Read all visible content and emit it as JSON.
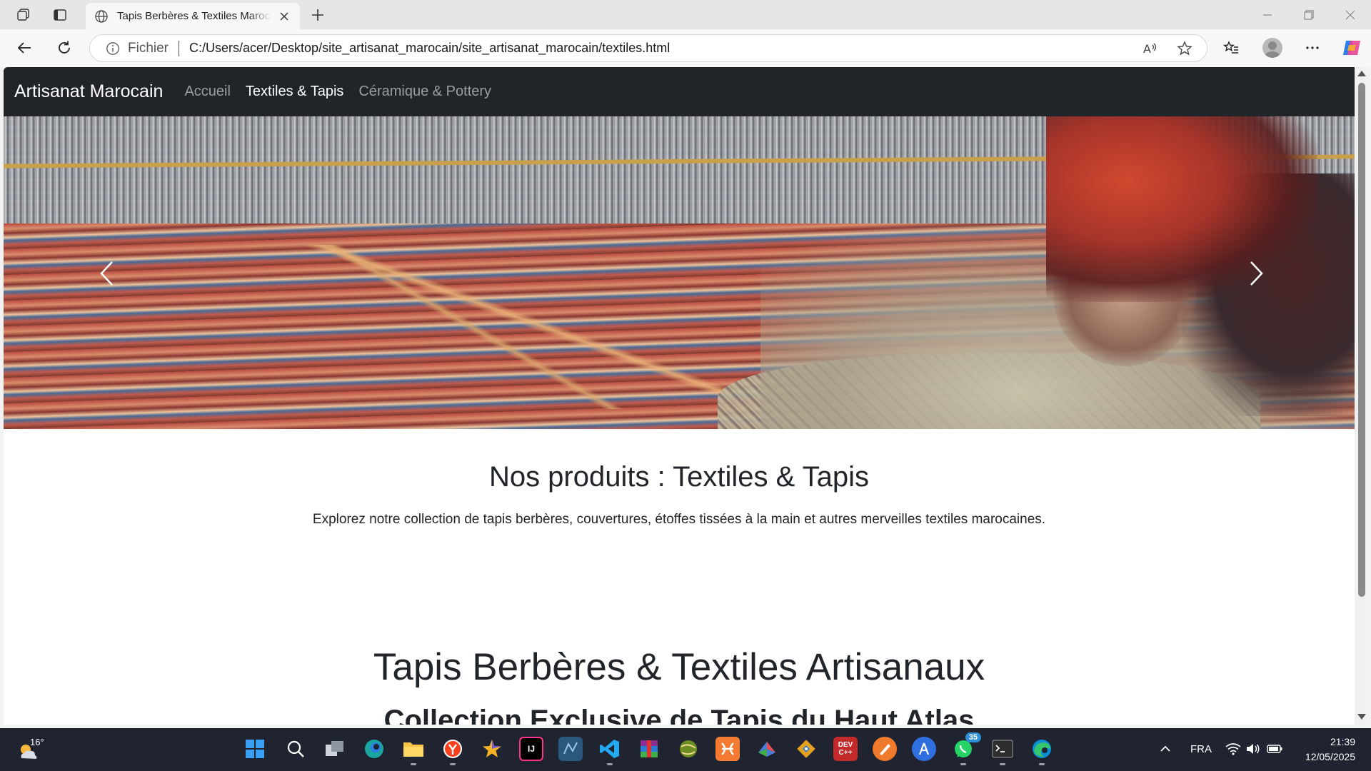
{
  "browser": {
    "tab": {
      "title": "Tapis Berbères & Textiles Marocains"
    },
    "address": {
      "scheme_label": "Fichier",
      "url": "C:/Users/acer/Desktop/site_artisanat_marocain/site_artisanat_marocain/textiles.html"
    }
  },
  "site": {
    "brand": "Artisanat Marocain",
    "nav": [
      {
        "label": "Accueil",
        "active": false
      },
      {
        "label": "Textiles & Tapis",
        "active": true
      },
      {
        "label": "Céramique & Pottery",
        "active": false
      }
    ],
    "products": {
      "heading": "Nos produits : Textiles & Tapis",
      "lead": "Explorez notre collection de tapis berbères, couvertures, étoffes tissées à la main et autres merveilles textiles marocaines."
    },
    "collection": {
      "heading": "Tapis Berbères & Textiles Artisanaux",
      "subheading": "Collection Exclusive de Tapis du Haut Atlas"
    }
  },
  "taskbar": {
    "weather_temp": "16°",
    "language": "FRA",
    "time": "21:39",
    "date": "12/05/2025",
    "whatsapp_badge": "35"
  }
}
